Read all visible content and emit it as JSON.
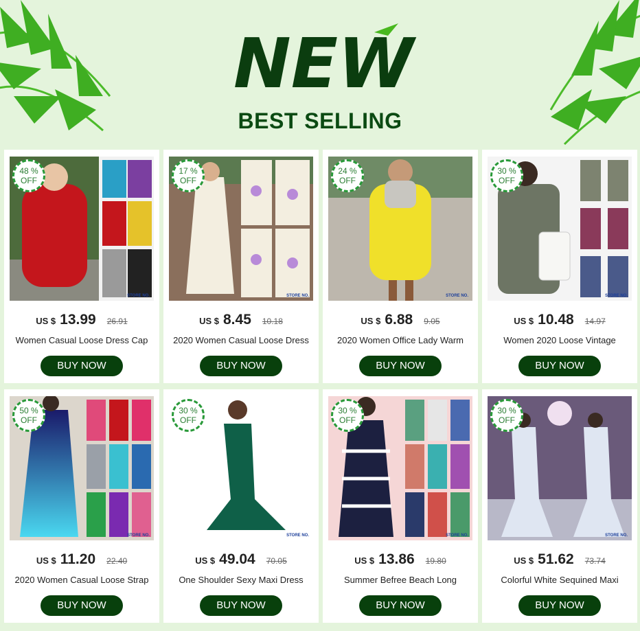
{
  "header": {
    "logo_text": "NEW",
    "title": "BEST SELLING"
  },
  "colors": {
    "background": "#e4f4dc",
    "title_green": "#0b4a12",
    "button": "#08400c",
    "badge_border": "#2a9a3a"
  },
  "products": [
    {
      "badge_pct": "48 %",
      "badge_off": "OFF",
      "currency": "US $",
      "price": "13.99",
      "old_price": "26.91",
      "name": "Women Casual Loose Dress Cap",
      "buy": "BUY NOW",
      "photo": "red-hoodie-dress"
    },
    {
      "badge_pct": "17 %",
      "badge_off": "OFF",
      "currency": "US $",
      "price": "8.45",
      "old_price": "10.18",
      "name": "2020 Women Casual Loose Dress",
      "buy": "BUY NOW",
      "photo": "printed-sleeveless-dress"
    },
    {
      "badge_pct": "24 %",
      "badge_off": "OFF",
      "currency": "US $",
      "price": "6.88",
      "old_price": "9.05",
      "name": "2020 Women Office Lady Warm",
      "buy": "BUY NOW",
      "photo": "yellow-sweater-dress"
    },
    {
      "badge_pct": "30 %",
      "badge_off": "OFF",
      "currency": "US $",
      "price": "10.48",
      "old_price": "14.97",
      "name": "Women 2020 Loose Vintage",
      "buy": "BUY NOW",
      "photo": "camo-tshirt-dress"
    },
    {
      "badge_pct": "50 %",
      "badge_off": "OFF",
      "currency": "US $",
      "price": "11.20",
      "old_price": "22.40",
      "name": "2020 Women Casual Loose Strap",
      "buy": "BUY NOW",
      "photo": "gradient-strap-dress"
    },
    {
      "badge_pct": "30 %",
      "badge_off": "OFF",
      "currency": "US $",
      "price": "49.04",
      "old_price": "70.05",
      "name": "One Shoulder Sexy Maxi Dress",
      "buy": "BUY NOW",
      "photo": "green-mermaid-gown"
    },
    {
      "badge_pct": "30 %",
      "badge_off": "OFF",
      "currency": "US $",
      "price": "13.86",
      "old_price": "19.80",
      "name": "Summer Befree Beach Long",
      "buy": "BUY NOW",
      "photo": "tie-dye-maxi-dress"
    },
    {
      "badge_pct": "30 %",
      "badge_off": "OFF",
      "currency": "US $",
      "price": "51.62",
      "old_price": "73.74",
      "name": "Colorful White Sequined Maxi",
      "buy": "BUY NOW",
      "photo": "sequin-mermaid-gown"
    }
  ]
}
